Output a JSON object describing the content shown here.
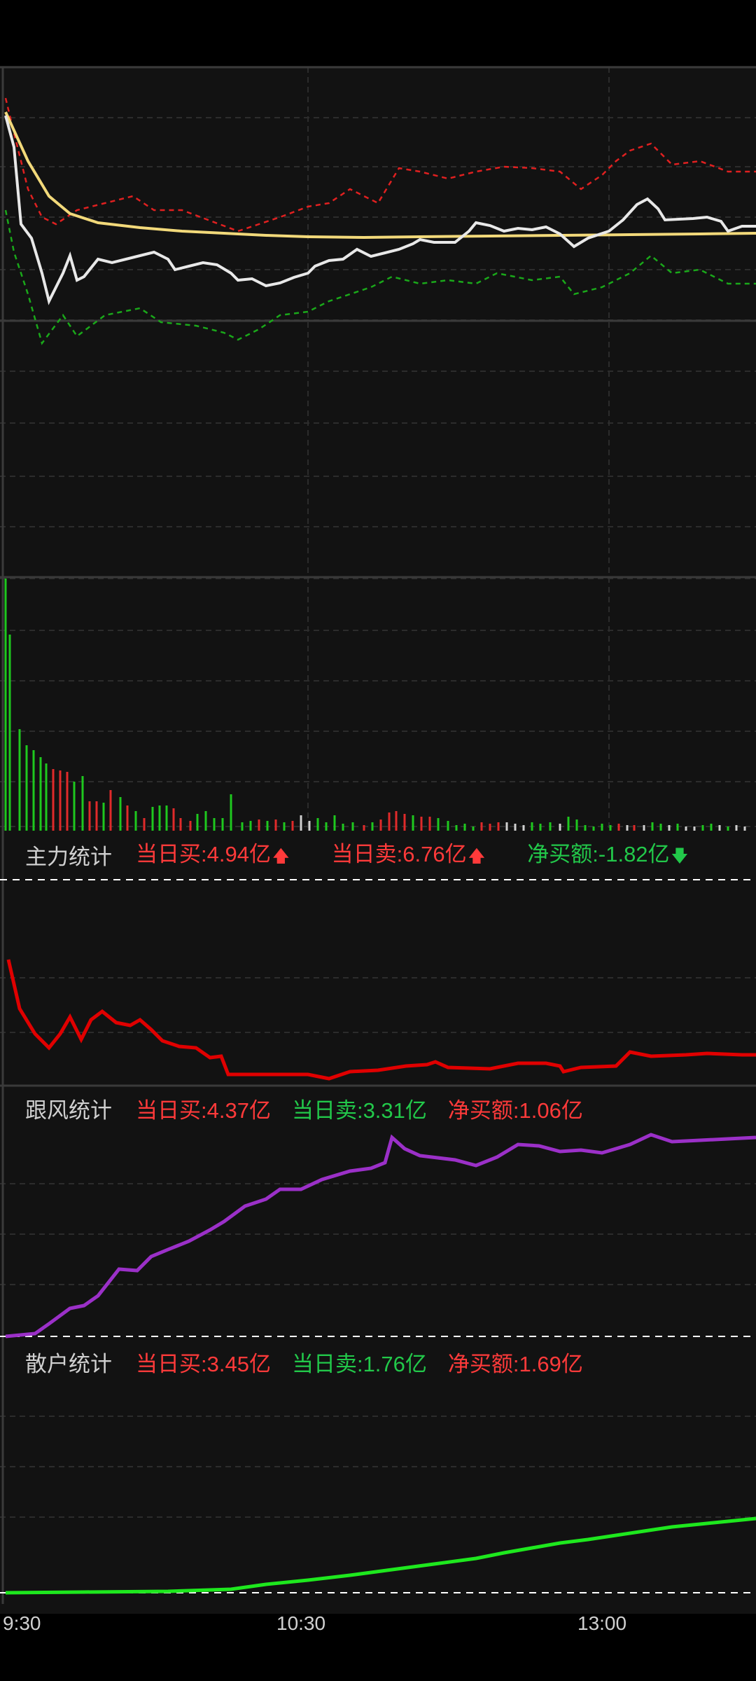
{
  "colors": {
    "background": "#121212",
    "price_line": "#e8e8e8",
    "avg_line": "#f2d97a",
    "upper_band": "#e02020",
    "lower_band": "#1aa81a",
    "main_force_line": "#e00000",
    "follower_line": "#9b30c8",
    "retail_line": "#1ee81e"
  },
  "main_force_stats": {
    "label": "主力统计",
    "buy": "当日买:4.94亿",
    "sell": "当日卖:6.76亿",
    "net": "净买额:-1.82亿",
    "buy_arrow": "arrow-up-icon",
    "sell_arrow": "arrow-up-icon",
    "net_arrow": "arrow-down-icon"
  },
  "follower_stats": {
    "label": "跟风统计",
    "buy": "当日买:4.37亿",
    "sell": "当日卖:3.31亿",
    "net": "净买额:1.06亿"
  },
  "retail_stats": {
    "label": "散户统计",
    "buy": "当日买:3.45亿",
    "sell": "当日卖:1.76亿",
    "net": "净买额:1.69亿"
  },
  "time_axis": [
    "9:30",
    "10:30",
    "13:00"
  ]
}
